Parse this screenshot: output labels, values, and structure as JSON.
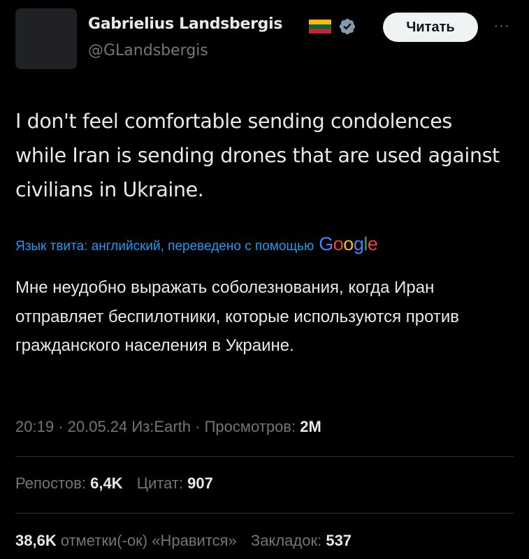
{
  "author": {
    "display_name": "Gabrielius Landsbergis",
    "handle": "@GLandsbergis",
    "flag_colors": [
      "#FDB913",
      "#006A44",
      "#C1272D"
    ]
  },
  "follow_label": "Читать",
  "more_label": "···",
  "tweet": {
    "text": "I don't feel comfortable sending condolences while Iran is sending drones that are used against civilians in Ukraine.",
    "translation_note": "Язык твита: английский, переведено с помощью",
    "translation_provider": "Google",
    "translated_text": "Мне неудобно выражать соболезнования, когда Иран отправляет беспилотники, которые используются против гражданского населения в Украине."
  },
  "meta": {
    "time": "20:19",
    "date": "20.05.24",
    "source": "Из:Earth",
    "views_label": "Просмотров:",
    "views_value": "2M"
  },
  "stats": {
    "reposts_label": "Репостов:",
    "reposts_value": "6,4K",
    "quotes_label": "Цитат:",
    "quotes_value": "907",
    "likes_value": "38,6K",
    "likes_label": "отметки(-ок) «Нравится»",
    "bookmarks_label": "Закладок:",
    "bookmarks_value": "537"
  },
  "colors": {
    "background": "#000000",
    "text": "#e7e9ea",
    "secondary": "#71767b",
    "link": "#1d9bf0",
    "verified": "#829aab"
  }
}
